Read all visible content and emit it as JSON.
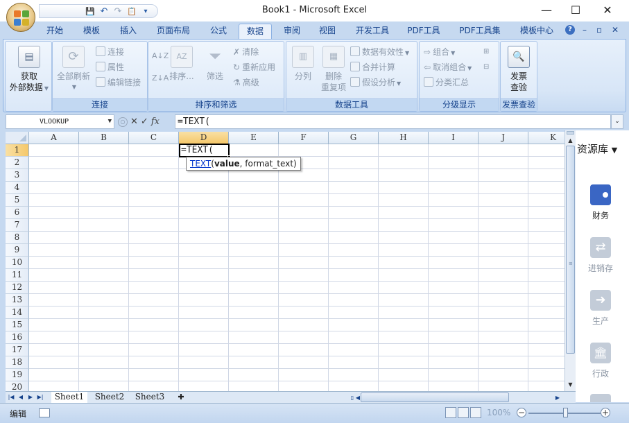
{
  "window": {
    "title": "Book1 - Microsoft Excel",
    "minimize": "—",
    "maximize": "☐",
    "close": "✕"
  },
  "qat": {
    "save": "💾",
    "undo": "↶",
    "redo": "↷",
    "paste": "📋",
    "customize": "▾"
  },
  "tabs": [
    {
      "label": "开始"
    },
    {
      "label": "模板"
    },
    {
      "label": "插入"
    },
    {
      "label": "页面布局"
    },
    {
      "label": "公式"
    },
    {
      "label": "数据"
    },
    {
      "label": "审阅"
    },
    {
      "label": "视图"
    },
    {
      "label": "开发工具"
    },
    {
      "label": "PDF工具"
    },
    {
      "label": "PDF工具集"
    },
    {
      "label": "模板中心"
    }
  ],
  "active_tab": "数据",
  "mdi_controls": {
    "help": "?",
    "minimize": "–",
    "restore": "▫",
    "close": "✕"
  },
  "ribbon": {
    "groups": {
      "external": {
        "label": "",
        "get_data_line1": "获取",
        "get_data_line2": "外部数据"
      },
      "connections": {
        "label": "连接",
        "refresh_all": "全部刷新",
        "connections": "连接",
        "properties": "属性",
        "edit_links": "编辑链接"
      },
      "sort_filter": {
        "label": "排序和筛选",
        "sort_asc": "A↓Z",
        "sort_desc": "Z↓A",
        "sort": "排序...",
        "filter": "筛选",
        "clear": "清除",
        "reapply": "重新应用",
        "advanced": "高级"
      },
      "data_tools": {
        "label": "数据工具",
        "text_to_columns": "分列",
        "remove_dup_line1": "删除",
        "remove_dup_line2": "重复项",
        "validation": "数据有效性",
        "consolidate": "合并计算",
        "what_if": "假设分析"
      },
      "outline": {
        "label": "分级显示",
        "group": "组合",
        "ungroup": "取消组合",
        "subtotal": "分类汇总"
      },
      "invoice": {
        "label": "发票查验",
        "btn_line1": "发票",
        "btn_line2": "查验"
      }
    }
  },
  "formula_bar": {
    "name_box": "VLOOKUP",
    "cancel": "✕",
    "enter": "✓",
    "fx": "fx",
    "formula": "=TEXT("
  },
  "grid": {
    "columns": [
      "A",
      "B",
      "C",
      "D",
      "E",
      "F",
      "G",
      "H",
      "I",
      "J",
      "K"
    ],
    "rows": [
      "1",
      "2",
      "3",
      "4",
      "5",
      "6",
      "7",
      "8",
      "9",
      "10",
      "11",
      "12",
      "13",
      "14",
      "15",
      "16",
      "17",
      "18",
      "19",
      "20"
    ],
    "active_column": "D",
    "active_row": "1",
    "active_cell_text": "=TEXT(",
    "tooltip": {
      "fn": "TEXT",
      "open": "(",
      "arg1": "value",
      "rest": ", format_text)"
    }
  },
  "side_panel": {
    "title": "资源库",
    "items": [
      {
        "label": "财务",
        "icon": "wallet-icon",
        "color": "#3a66c4"
      },
      {
        "label": "进销存",
        "icon": "exchange-icon",
        "color": "#c3ccd8"
      },
      {
        "label": "生产",
        "icon": "arrow-right-icon",
        "color": "#c3ccd8"
      },
      {
        "label": "行政",
        "icon": "building-icon",
        "color": "#c3ccd8"
      }
    ]
  },
  "sheets": {
    "tabs": [
      {
        "label": "Sheet1"
      },
      {
        "label": "Sheet2"
      },
      {
        "label": "Sheet3"
      }
    ],
    "active": "Sheet1"
  },
  "status": {
    "mode": "编辑",
    "zoom": "100%",
    "zoom_out": "−",
    "zoom_in": "+"
  },
  "colors": {
    "accent": "#15428b",
    "ribbon_bg": "#dbe8f8",
    "selected_header": "#f5c86a"
  }
}
